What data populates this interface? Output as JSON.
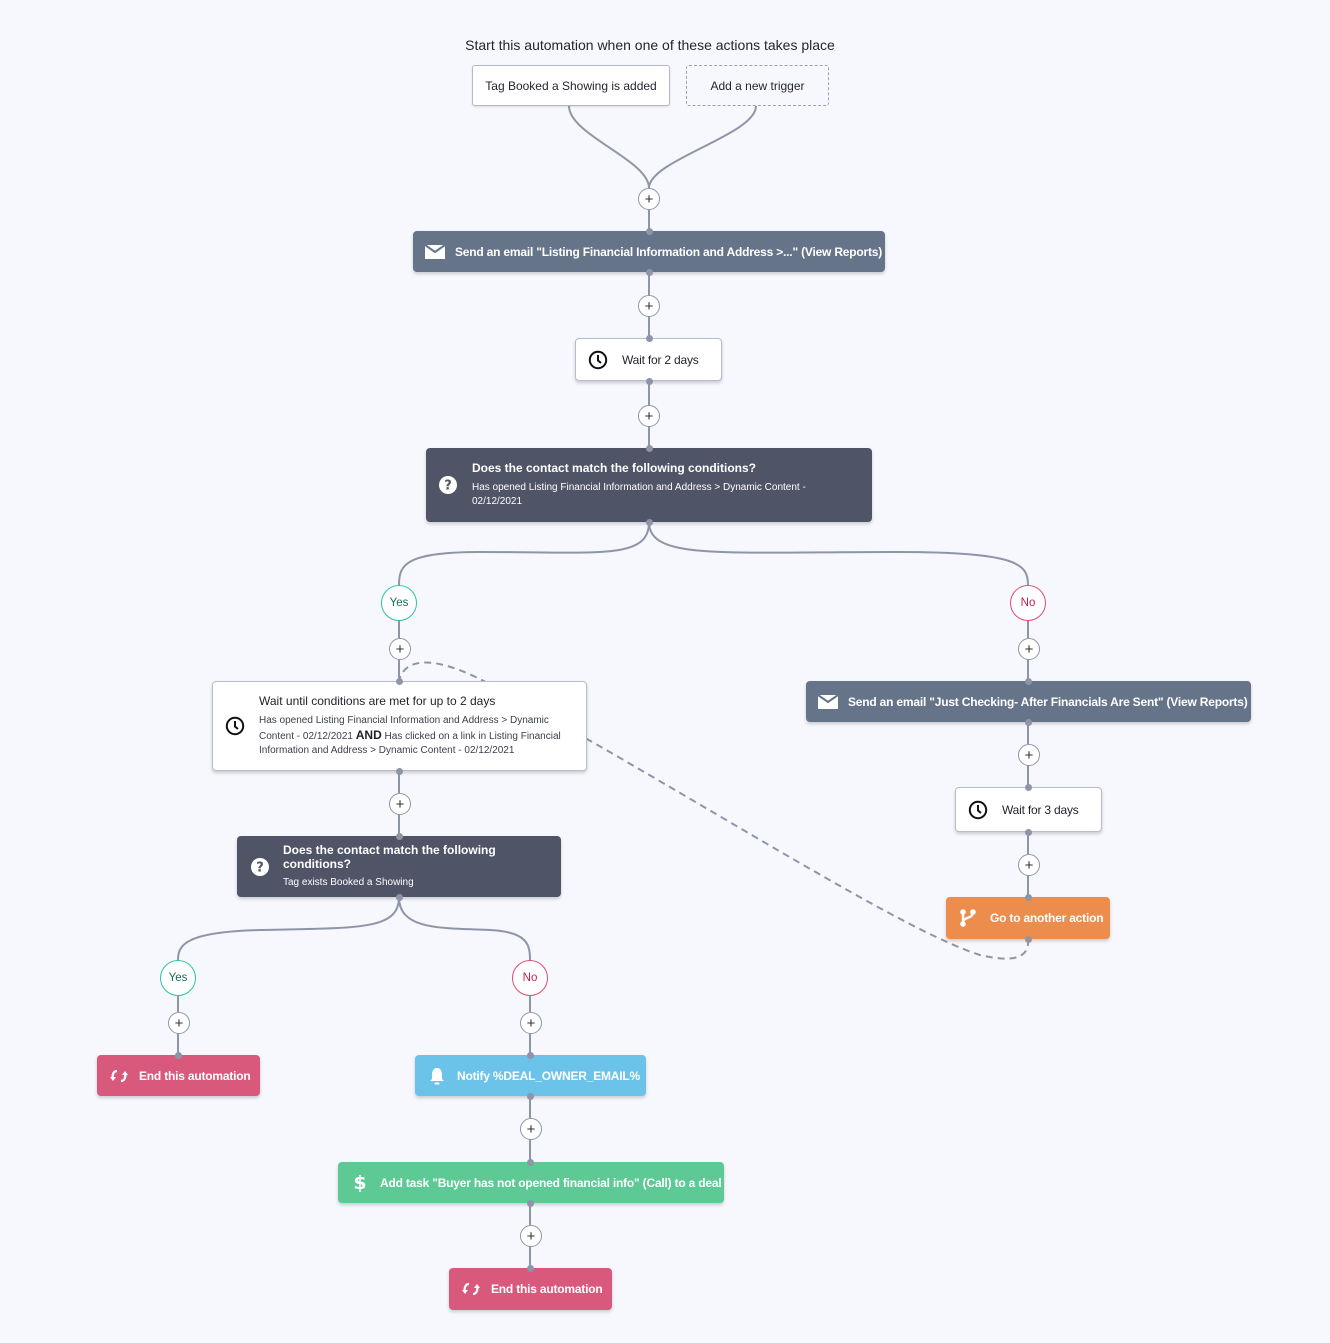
{
  "heading": "Start this automation when one of these actions takes place",
  "triggers": [
    {
      "label": "Tag Booked a Showing is added"
    },
    {
      "label": "Add a new trigger"
    }
  ],
  "colors": {
    "background": "#f7f8fd",
    "email_action": "#667489",
    "condition": "#4f5467",
    "goto": "#ec8c4d",
    "notify": "#6cc3ea",
    "task": "#5dc994",
    "end": "#d9597c",
    "yes_branch": "#2ec4a0",
    "no_branch": "#e04b75",
    "connector": "#8f95a8"
  },
  "add_step_symbol": "+",
  "steps": {
    "email1": {
      "icon": "envelope-icon",
      "label": "Send an email \"Listing Financial Information and Address >...\" (View Reports)"
    },
    "wait1": {
      "icon": "clock-icon",
      "label": "Wait for 2 days"
    },
    "condition1": {
      "icon": "question-icon",
      "title": "Does the contact match the following conditions?",
      "detail_line1": "Has opened Listing Financial Information and Address > Dynamic Content -",
      "detail_line2": "02/12/2021"
    },
    "branch1_yes": "Yes",
    "branch1_no": "No",
    "wait_until": {
      "icon": "clock-icon",
      "title": "Wait until conditions are met for up to 2 days",
      "cond_a": "Has opened Listing Financial Information and Address > Dynamic Content - 02/12/2021",
      "joiner": "AND",
      "cond_b": "Has clicked on a link in Listing Financial Information and Address > Dynamic Content - 02/12/2021"
    },
    "condition2": {
      "icon": "question-icon",
      "title": "Does the contact match the following conditions?",
      "detail": "Tag exists Booked a Showing"
    },
    "branch2_yes": "Yes",
    "branch2_no": "No",
    "end_yes": {
      "icon": "end-loop-icon",
      "label": "End this automation"
    },
    "notify": {
      "icon": "bell-icon",
      "label": "Notify %DEAL_OWNER_EMAIL%"
    },
    "task": {
      "icon": "dollar-icon",
      "label": "Add task \"Buyer has not opened financial info\" (Call) to a deal"
    },
    "end_no": {
      "icon": "end-loop-icon",
      "label": "End this automation"
    },
    "email2": {
      "icon": "envelope-icon",
      "label": "Send an email \"Just Checking- After Financials Are Sent\" (View Reports)"
    },
    "wait2": {
      "icon": "clock-icon",
      "label": "Wait for 3 days"
    },
    "goto": {
      "icon": "branch-icon",
      "label": "Go to another action"
    }
  }
}
